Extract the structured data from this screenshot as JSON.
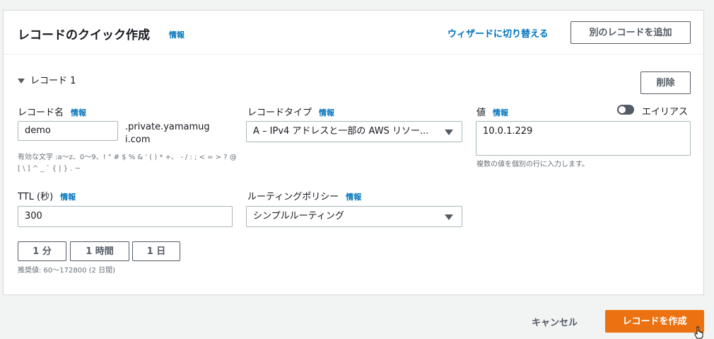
{
  "header": {
    "title": "レコードのクイック作成",
    "info": "情報",
    "wizard_link": "ウィザードに切り替える",
    "add_record": "別のレコードを追加"
  },
  "record": {
    "toggle_label": "レコード 1",
    "delete": "削除",
    "name": {
      "label": "レコード名",
      "info": "情報",
      "value": "demo",
      "suffix": ".private.yamamugi.com",
      "hint": "有効な文字 :a〜z、0〜9、! \" # $ % & ' ( ) * +、 - / : ; < = > ? @ [ \\ ] ^ _ ` { | } . ~"
    },
    "type": {
      "label": "レコードタイプ",
      "info": "情報",
      "value": "A – IPv4 アドレスと一部の AWS リソー..."
    },
    "value": {
      "label": "値",
      "info": "情報",
      "text": "10.0.1.229",
      "hint": "複数の値を個別の行に入力します。",
      "alias_label": "エイリアス",
      "alias_on": false
    },
    "ttl": {
      "label": "TTL (秒)",
      "info": "情報",
      "value": "300",
      "buttons": [
        "1 分",
        "1 時間",
        "1 日"
      ],
      "hint": "推奨値: 60〜172800 (2 日間)"
    },
    "routing": {
      "label": "ルーティングポリシー",
      "info": "情報",
      "value": "シンプルルーティング"
    }
  },
  "footer": {
    "cancel": "キャンセル",
    "create": "レコードを作成"
  },
  "colors": {
    "link": "#0073bb",
    "primary": "#ec7211",
    "border": "#aab7b8"
  }
}
